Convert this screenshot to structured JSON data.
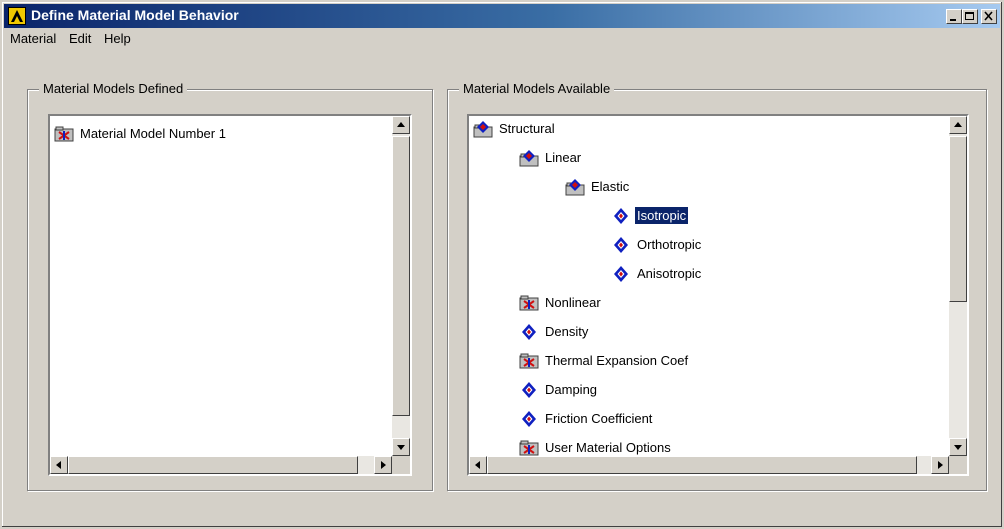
{
  "window": {
    "title": "Define Material Model Behavior",
    "controls": [
      "minimize-icon",
      "maximize-icon",
      "close-icon"
    ]
  },
  "menu": [
    "Material",
    "Edit",
    "Help"
  ],
  "left_panel": {
    "label": "Material Models Defined",
    "items": [
      "Material Model Number 1"
    ]
  },
  "right_panel": {
    "label": "Material Models Available",
    "tree": [
      {
        "label": "Structural",
        "icon": "folder-stack-icon",
        "level": 0
      },
      {
        "label": "Linear",
        "icon": "folder-stack-icon",
        "level": 1
      },
      {
        "label": "Elastic",
        "icon": "folder-stack-icon",
        "level": 2
      },
      {
        "label": "Isotropic",
        "icon": "material-diamond-icon",
        "level": 3,
        "selected": true
      },
      {
        "label": "Orthotropic",
        "icon": "material-diamond-icon",
        "level": 3
      },
      {
        "label": "Anisotropic",
        "icon": "material-diamond-icon",
        "level": 3
      },
      {
        "label": "Nonlinear",
        "icon": "folder-closed-icon",
        "level": 1
      },
      {
        "label": "Density",
        "icon": "material-diamond-icon",
        "level": 1
      },
      {
        "label": "Thermal Expansion Coef",
        "icon": "folder-closed-icon",
        "level": 1
      },
      {
        "label": "Damping",
        "icon": "material-diamond-icon",
        "level": 1
      },
      {
        "label": "Friction Coefficient",
        "icon": "material-diamond-icon",
        "level": 1
      },
      {
        "label": "User Material Options",
        "icon": "folder-closed-icon",
        "level": 1
      }
    ]
  },
  "colors": {
    "selection": "#0a246a",
    "face": "#d4d0c8",
    "icon_blue": "#1020c0",
    "icon_red": "#d01010"
  }
}
